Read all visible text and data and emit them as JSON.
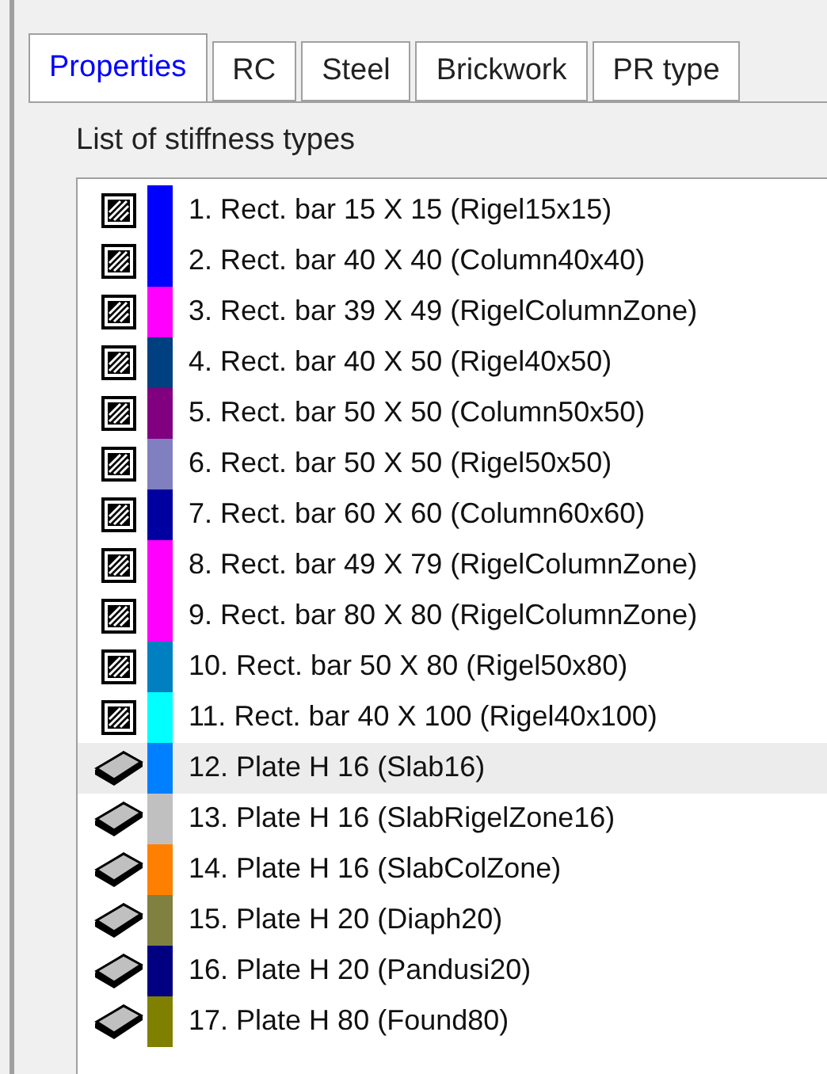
{
  "tabs": [
    {
      "label": "Properties",
      "selected": true
    },
    {
      "label": "RC",
      "selected": false
    },
    {
      "label": "Steel",
      "selected": false
    },
    {
      "label": "Brickwork",
      "selected": false
    },
    {
      "label": "PR type",
      "selected": false
    }
  ],
  "list_label": "List of stiffness types",
  "items": [
    {
      "kind": "bar",
      "color": "#0000ff",
      "label": "1. Rect. bar 15 X 15 (Rigel15x15)",
      "selected": false
    },
    {
      "kind": "bar",
      "color": "#0000ff",
      "label": "2. Rect. bar 40 X 40 (Column40x40)",
      "selected": false
    },
    {
      "kind": "bar",
      "color": "#ff00ff",
      "label": "3. Rect. bar 39 X 49 (RigelColumnZone)",
      "selected": false
    },
    {
      "kind": "bar",
      "color": "#004080",
      "label": "4. Rect. bar 40 X 50 (Rigel40x50)",
      "selected": false
    },
    {
      "kind": "bar",
      "color": "#800080",
      "label": "5. Rect. bar 50 X 50 (Column50x50)",
      "selected": false
    },
    {
      "kind": "bar",
      "color": "#8080c0",
      "label": "6. Rect. bar 50 X 50 (Rigel50x50)",
      "selected": false
    },
    {
      "kind": "bar",
      "color": "#0000a0",
      "label": "7. Rect. bar 60 X 60 (Column60x60)",
      "selected": false
    },
    {
      "kind": "bar",
      "color": "#ff00ff",
      "label": "8. Rect. bar 49 X 79 (RigelColumnZone)",
      "selected": false
    },
    {
      "kind": "bar",
      "color": "#ff00ff",
      "label": "9. Rect. bar 80 X 80 (RigelColumnZone)",
      "selected": false
    },
    {
      "kind": "bar",
      "color": "#0080c0",
      "label": "10. Rect. bar 50 X 80 (Rigel50x80)",
      "selected": false
    },
    {
      "kind": "bar",
      "color": "#00ffff",
      "label": "11. Rect. bar 40 X 100 (Rigel40x100)",
      "selected": false
    },
    {
      "kind": "plate",
      "color": "#0080ff",
      "label": "12. Plate H 16 (Slab16)",
      "selected": true
    },
    {
      "kind": "plate",
      "color": "#c0c0c0",
      "label": "13. Plate H 16 (SlabRigelZone16)",
      "selected": false
    },
    {
      "kind": "plate",
      "color": "#ff8000",
      "label": "14. Plate H 16 (SlabColZone)",
      "selected": false
    },
    {
      "kind": "plate",
      "color": "#808040",
      "label": "15. Plate H 20 (Diaph20)",
      "selected": false
    },
    {
      "kind": "plate",
      "color": "#000080",
      "label": "16. Plate H 20 (Pandusi20)",
      "selected": false
    },
    {
      "kind": "plate",
      "color": "#808000",
      "label": "17. Plate H 80 (Found80)",
      "selected": false
    }
  ]
}
